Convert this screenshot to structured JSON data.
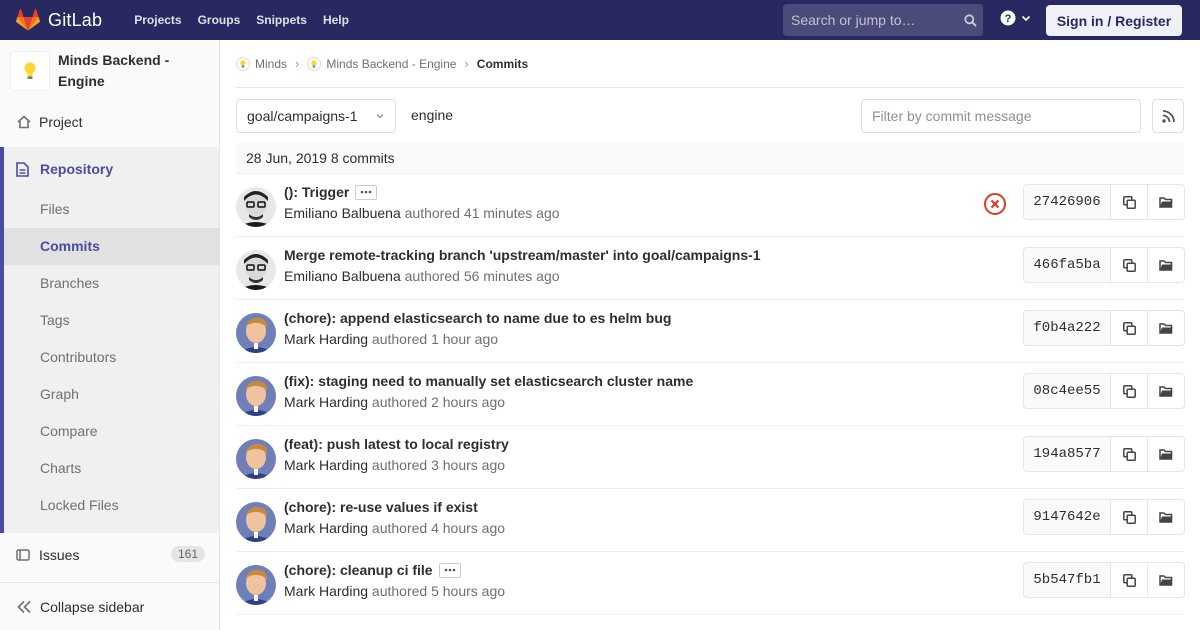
{
  "navbar": {
    "brand": "GitLab",
    "links": [
      "Projects",
      "Groups",
      "Snippets",
      "Help"
    ],
    "search_placeholder": "Search or jump to…",
    "signin_label": "Sign in / Register"
  },
  "sidebar": {
    "project_name_line1": "Minds Backend -",
    "project_name_line2": "Engine",
    "project_label": "Project",
    "repository_label": "Repository",
    "repo_items": [
      "Files",
      "Commits",
      "Branches",
      "Tags",
      "Contributors",
      "Graph",
      "Compare",
      "Charts",
      "Locked Files"
    ],
    "active_item": "Commits",
    "issues_label": "Issues",
    "issues_count": "161",
    "collapse_label": "Collapse sidebar"
  },
  "breadcrumb": {
    "items": [
      "Minds",
      "Minds Backend - Engine"
    ],
    "current": "Commits"
  },
  "controls": {
    "branch": "goal/campaigns-1",
    "path": "engine",
    "filter_placeholder": "Filter by commit message"
  },
  "day_header": "28 Jun, 2019 8 commits",
  "commits": [
    {
      "title": "(): Trigger",
      "author": "Emiliano Balbuena",
      "authored": "authored",
      "time": "41 minutes ago",
      "sha": "27426906",
      "has_ellipsis": true,
      "status": "failed"
    },
    {
      "title": "Merge remote-tracking branch 'upstream/master' into goal/campaigns-1",
      "author": "Emiliano Balbuena",
      "authored": "authored",
      "time": "56 minutes ago",
      "sha": "466fa5ba",
      "has_ellipsis": false,
      "status": ""
    },
    {
      "title": "(chore): append elasticsearch to name due to es helm bug",
      "author": "Mark Harding",
      "authored": "authored",
      "time": "1 hour ago",
      "sha": "f0b4a222",
      "has_ellipsis": false,
      "status": ""
    },
    {
      "title": "(fix): staging need to manually set elasticsearch cluster name",
      "author": "Mark Harding",
      "authored": "authored",
      "time": "2 hours ago",
      "sha": "08c4ee55",
      "has_ellipsis": false,
      "status": ""
    },
    {
      "title": "(feat): push latest to local registry",
      "author": "Mark Harding",
      "authored": "authored",
      "time": "3 hours ago",
      "sha": "194a8577",
      "has_ellipsis": false,
      "status": ""
    },
    {
      "title": "(chore): re-use values if exist",
      "author": "Mark Harding",
      "authored": "authored",
      "time": "4 hours ago",
      "sha": "9147642e",
      "has_ellipsis": false,
      "status": ""
    },
    {
      "title": "(chore): cleanup ci file",
      "author": "Mark Harding",
      "authored": "authored",
      "time": "5 hours ago",
      "sha": "5b547fb1",
      "has_ellipsis": true,
      "status": ""
    }
  ],
  "colors": {
    "navbar": "#292961",
    "accent": "#4b4ba3",
    "failed": "#db3b21"
  }
}
